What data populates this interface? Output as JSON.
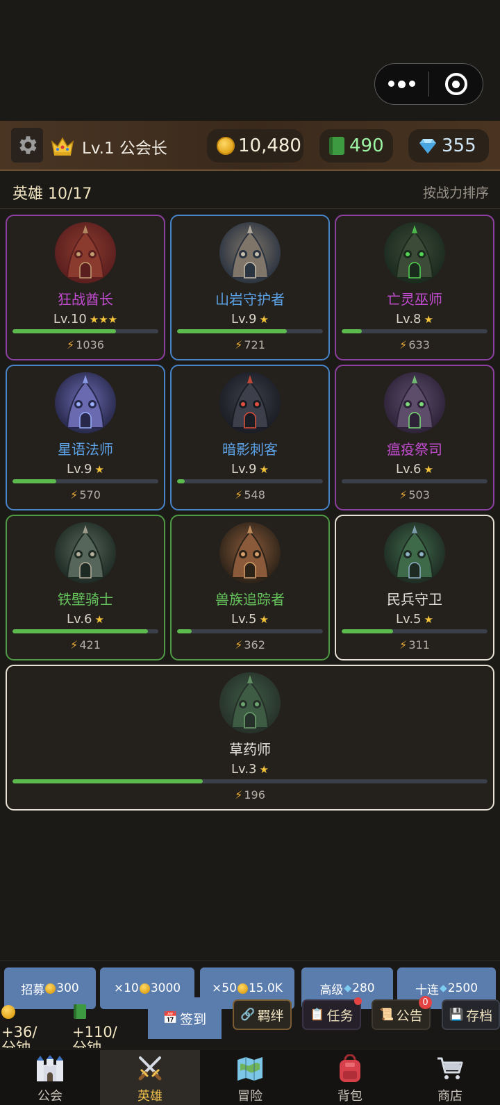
{
  "topbar": {
    "rank": "Lv.1 公会长",
    "gold": "10,480",
    "books": "490",
    "gems": "355"
  },
  "heroes_header": {
    "title": "英雄 10/17",
    "sort_label": "按战力排序"
  },
  "heroes": [
    {
      "name": "狂战酋长",
      "level": "Lv.10",
      "stars": "★★★",
      "power": "1036",
      "rarity": "purple",
      "xp_progress": 0.71
    },
    {
      "name": "山岩守护者",
      "level": "Lv.9",
      "stars": "★",
      "power": "721",
      "rarity": "blue",
      "xp_progress": 0.75
    },
    {
      "name": "亡灵巫师",
      "level": "Lv.8",
      "stars": "★",
      "power": "633",
      "rarity": "purple",
      "xp_progress": 0.14
    },
    {
      "name": "星语法师",
      "level": "Lv.9",
      "stars": "★",
      "power": "570",
      "rarity": "blue",
      "xp_progress": 0.3
    },
    {
      "name": "暗影刺客",
      "level": "Lv.9",
      "stars": "★",
      "power": "548",
      "rarity": "blue",
      "xp_progress": 0.05
    },
    {
      "name": "瘟疫祭司",
      "level": "Lv.6",
      "stars": "★",
      "power": "503",
      "rarity": "purple",
      "xp_progress": 0.0
    },
    {
      "name": "铁壁骑士",
      "level": "Lv.6",
      "stars": "★",
      "power": "421",
      "rarity": "green",
      "xp_progress": 0.93
    },
    {
      "name": "兽族追踪者",
      "level": "Lv.5",
      "stars": "★",
      "power": "362",
      "rarity": "green",
      "xp_progress": 0.1
    },
    {
      "name": "民兵守卫",
      "level": "Lv.5",
      "stars": "★",
      "power": "311",
      "rarity": "white",
      "xp_progress": 0.35
    },
    {
      "name": "草药师",
      "level": "Lv.3",
      "stars": "★",
      "power": "196",
      "rarity": "white",
      "xp_progress": 0.4
    }
  ],
  "recruit": {
    "single_label": "招募",
    "single_cost": "300",
    "x10_label": "×10",
    "x10_cost": "3000",
    "x50_label": "×50",
    "x50_cost": "15.0K",
    "advanced_label": "高级",
    "advanced_cost": "280",
    "ten_label": "十连",
    "ten_cost": "2500"
  },
  "income": {
    "gold_rate": "+36/",
    "gold_unit": "分钟",
    "book_rate": "+110/",
    "book_unit": "分钟"
  },
  "actions": {
    "checkin": "签到",
    "bonds": "羁绊",
    "tasks": "任务",
    "notice": "公告",
    "notice_badge": "0",
    "save": "存档"
  },
  "nav": {
    "guild": "公会",
    "heroes": "英雄",
    "adventure": "冒险",
    "bag": "背包",
    "shop": "商店"
  },
  "colors": {
    "purple": "#8d3ea1",
    "blue": "#4784c8",
    "green": "#4e9b44",
    "white": "#a7a7a7",
    "accent": "#f0c04d"
  }
}
